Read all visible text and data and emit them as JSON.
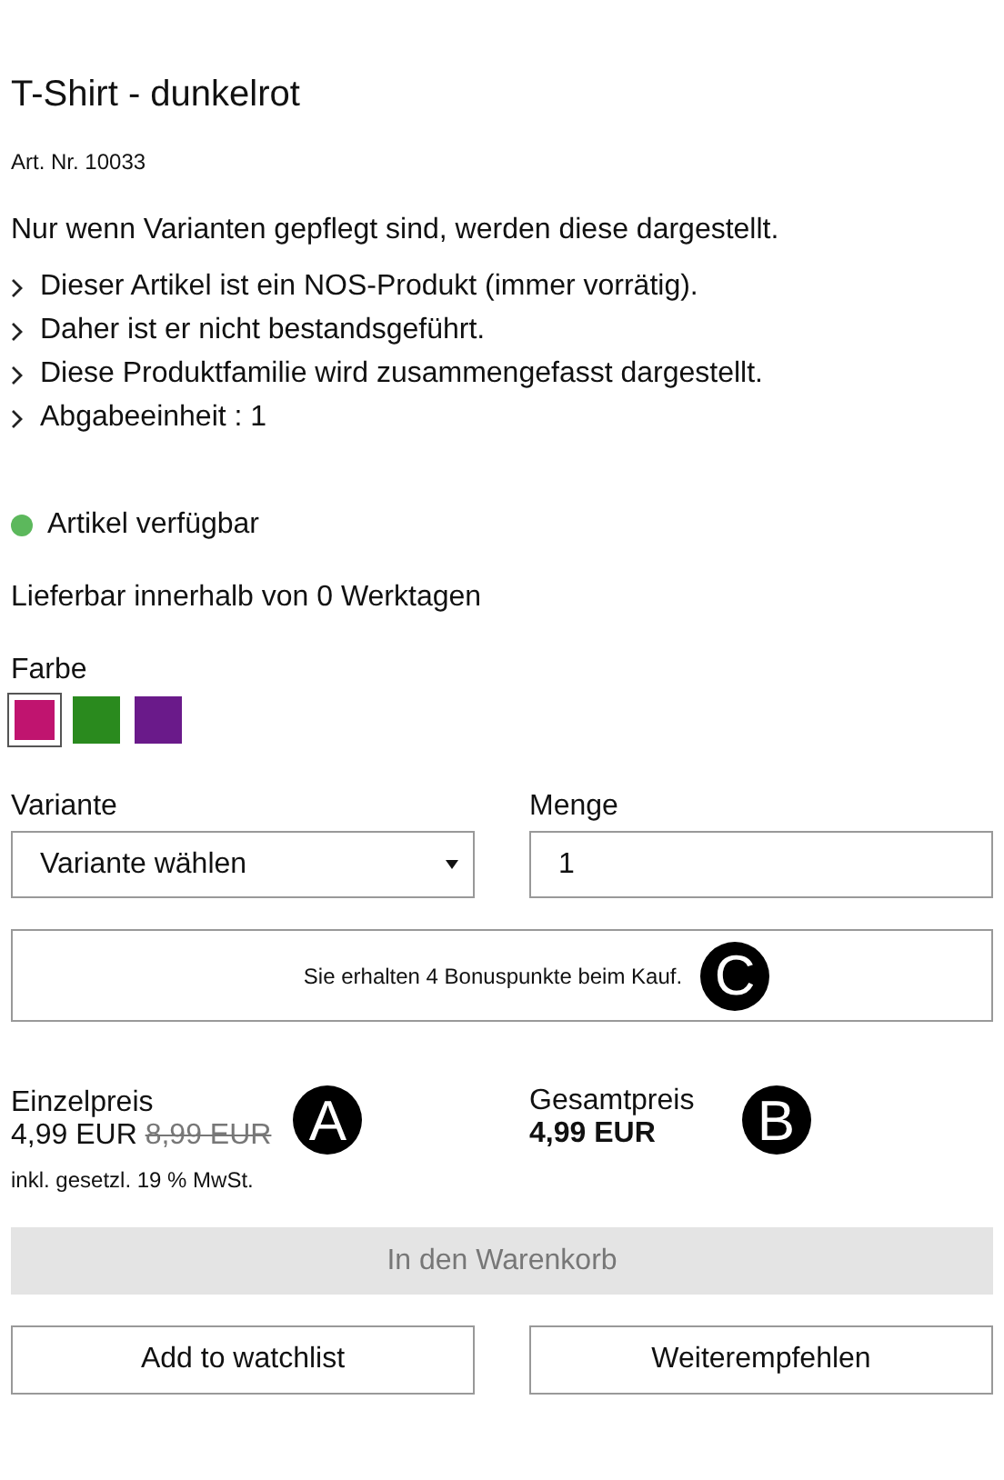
{
  "product": {
    "title": "T-Shirt - dunkelrot",
    "article_number": "Art. Nr. 10033",
    "note": "Nur wenn Varianten gepflegt sind, werden diese dargestellt.",
    "features": [
      "Dieser Artikel ist ein NOS-Produkt (immer vorrätig).",
      "Daher ist er nicht bestandsgeführt.",
      "Diese Produktfamilie wird zusammengefasst dargestellt.",
      "Abgabeeinheit : 1"
    ]
  },
  "availability": {
    "label": "Artikel verfügbar",
    "color": "#5cb85c"
  },
  "delivery": "Lieferbar innerhalb von 0 Werktagen",
  "color_picker": {
    "label": "Farbe",
    "swatches": [
      {
        "color": "#c0146f",
        "selected": true
      },
      {
        "color": "#2a8a1e",
        "selected": false
      },
      {
        "color": "#6a1a8a",
        "selected": false
      }
    ]
  },
  "variant": {
    "label": "Variante",
    "value": "Variante wählen"
  },
  "quantity": {
    "label": "Menge",
    "value": "1"
  },
  "bonus": {
    "text": "Sie erhalten 4 Bonuspunkte beim Kauf.",
    "callout": "C"
  },
  "unit_price": {
    "label": "Einzelpreis",
    "price": "4,99 EUR",
    "old_price": "8,99 EUR",
    "tax_note": "inkl. gesetzl. 19 % MwSt.",
    "callout": "A"
  },
  "total_price": {
    "label": "Gesamtpreis",
    "price": "4,99 EUR",
    "callout": "B"
  },
  "cart_button": {
    "label": "In den Warenkorb",
    "disabled": true
  },
  "buttons": [
    "Add to watchlist",
    "Weiterempfehlen"
  ]
}
